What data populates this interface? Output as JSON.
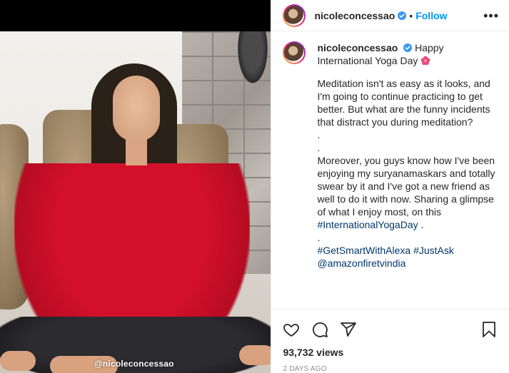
{
  "post": {
    "watermark": "@nicoleconcessao"
  },
  "header": {
    "username": "nicoleconcessao",
    "separator": "•",
    "follow_label": "Follow",
    "more_label": "•••"
  },
  "caption": {
    "username": "nicoleconcessao",
    "line1": "Happy International Yoga Day",
    "para1": "Meditation isn't as easy as it looks, and I'm going to continue practicing to get better. But what are the funny incidents that distract you during meditation?",
    "dot1": ".",
    "dot2": ".",
    "para2_text": "Moreover, you guys know how I've been enjoying my suryanamaskars and totally swear by it and I've got a new friend as well to do it with now. Sharing a glimpse of what I enjoy most, on this ",
    "para2_tag": "#InternationalYogaDay",
    "para2_end": " .",
    "dot3": ".",
    "tags_line": "#GetSmartWithAlexa #JustAsk",
    "mention": "@amazonfiretvindia"
  },
  "actions": {
    "views": "93,732 views",
    "time_ago": "2 DAYS AGO"
  },
  "icons": [
    "heart-icon",
    "comment-icon",
    "share-icon",
    "bookmark-icon",
    "verified-badge-icon",
    "hibiscus-emoji",
    "more-options-icon"
  ],
  "colors": {
    "link": "#0095f6",
    "hashtag": "#00376b",
    "muted": "#8e8e8e",
    "shirt": "#d3102a"
  }
}
